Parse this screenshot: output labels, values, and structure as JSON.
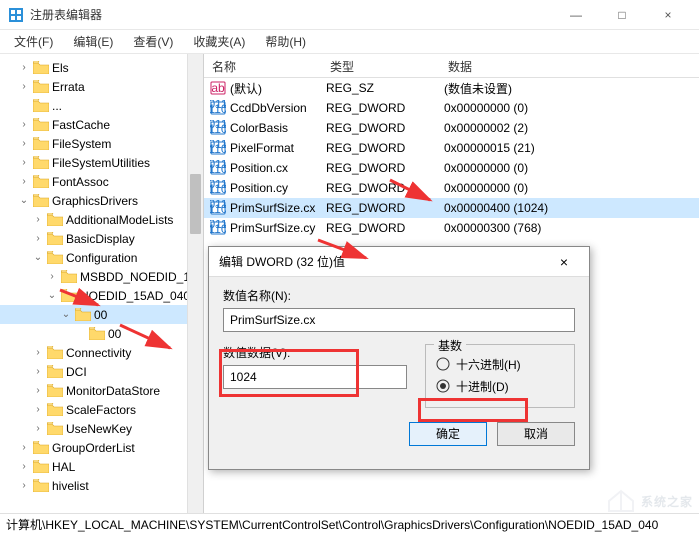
{
  "window": {
    "title": "注册表编辑器",
    "min": "—",
    "max": "□",
    "close": "×"
  },
  "menu": {
    "file": "文件(F)",
    "edit": "编辑(E)",
    "view": "查看(V)",
    "favorites": "收藏夹(A)",
    "help": "帮助(H)"
  },
  "tree": [
    {
      "d": 1,
      "t": ">",
      "l": "Els"
    },
    {
      "d": 1,
      "t": ">",
      "l": "Errata"
    },
    {
      "d": 1,
      "t": "",
      "l": "..."
    },
    {
      "d": 1,
      "t": ">",
      "l": "FastCache"
    },
    {
      "d": 1,
      "t": ">",
      "l": "FileSystem"
    },
    {
      "d": 1,
      "t": ">",
      "l": "FileSystemUtilities"
    },
    {
      "d": 1,
      "t": ">",
      "l": "FontAssoc"
    },
    {
      "d": 1,
      "t": "v",
      "l": "GraphicsDrivers"
    },
    {
      "d": 2,
      "t": ">",
      "l": "AdditionalModeLists"
    },
    {
      "d": 2,
      "t": ">",
      "l": "BasicDisplay"
    },
    {
      "d": 2,
      "t": "v",
      "l": "Configuration"
    },
    {
      "d": 3,
      "t": ">",
      "l": "MSBDD_NOEDID_1"
    },
    {
      "d": 3,
      "t": "v",
      "l": "NOEDID_15AD_040"
    },
    {
      "d": 4,
      "t": "v",
      "l": "00",
      "sel": true
    },
    {
      "d": 5,
      "t": "",
      "l": "00"
    },
    {
      "d": 2,
      "t": ">",
      "l": "Connectivity"
    },
    {
      "d": 2,
      "t": ">",
      "l": "DCI"
    },
    {
      "d": 2,
      "t": ">",
      "l": "MonitorDataStore"
    },
    {
      "d": 2,
      "t": ">",
      "l": "ScaleFactors"
    },
    {
      "d": 2,
      "t": ">",
      "l": "UseNewKey"
    },
    {
      "d": 1,
      "t": ">",
      "l": "GroupOrderList"
    },
    {
      "d": 1,
      "t": ">",
      "l": "HAL"
    },
    {
      "d": 1,
      "t": ">",
      "l": "hivelist"
    }
  ],
  "cols": {
    "name": "名称",
    "type": "类型",
    "data": "数据"
  },
  "rows": [
    {
      "ic": "sz",
      "n": "(默认)",
      "t": "REG_SZ",
      "d": "(数值未设置)"
    },
    {
      "ic": "dw",
      "n": "CcdDbVersion",
      "t": "REG_DWORD",
      "d": "0x00000000 (0)"
    },
    {
      "ic": "dw",
      "n": "ColorBasis",
      "t": "REG_DWORD",
      "d": "0x00000002 (2)"
    },
    {
      "ic": "dw",
      "n": "PixelFormat",
      "t": "REG_DWORD",
      "d": "0x00000015 (21)"
    },
    {
      "ic": "dw",
      "n": "Position.cx",
      "t": "REG_DWORD",
      "d": "0x00000000 (0)"
    },
    {
      "ic": "dw",
      "n": "Position.cy",
      "t": "REG_DWORD",
      "d": "0x00000000 (0)"
    },
    {
      "ic": "dw",
      "n": "PrimSurfSize.cx",
      "t": "REG_DWORD",
      "d": "0x00000400 (1024)",
      "sel": true
    },
    {
      "ic": "dw",
      "n": "PrimSurfSize.cy",
      "t": "REG_DWORD",
      "d": "0x00000300 (768)"
    }
  ],
  "dialog": {
    "title": "编辑 DWORD (32 位)值",
    "name_label": "数值名称(N):",
    "name_value": "PrimSurfSize.cx",
    "data_label": "数值数据(V):",
    "data_value": "1024",
    "base_label": "基数",
    "hex": "十六进制(H)",
    "dec": "十进制(D)",
    "ok": "确定",
    "cancel": "取消",
    "close": "×"
  },
  "status": "计算机\\HKEY_LOCAL_MACHINE\\SYSTEM\\CurrentControlSet\\Control\\GraphicsDrivers\\Configuration\\NOEDID_15AD_040",
  "watermark": "系统之家"
}
